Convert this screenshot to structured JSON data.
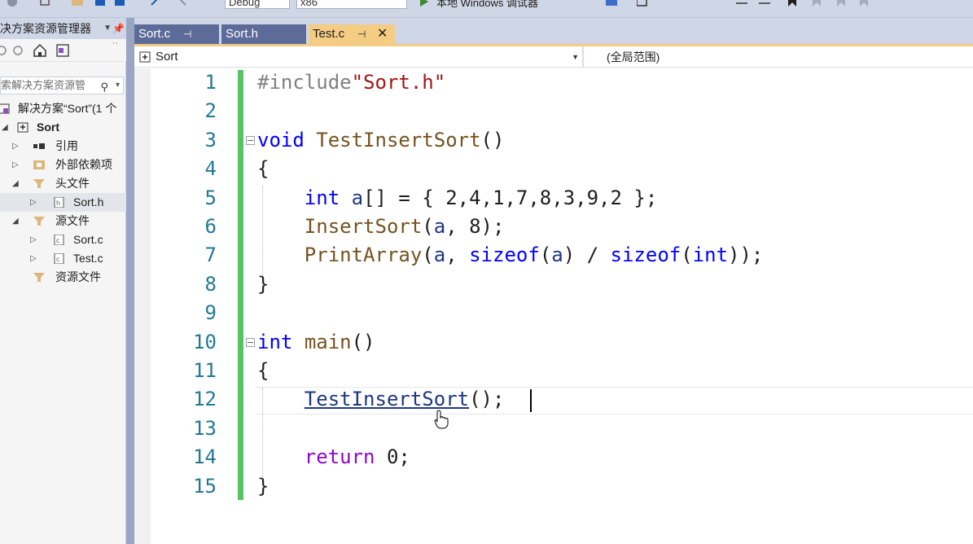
{
  "toolbar": {
    "config_value": "Debug",
    "platform_value": "x86",
    "run_label": "本地 Windows 调试器"
  },
  "explorer": {
    "title": "决方案资源管理器",
    "search_placeholder": "索解决方案资源管",
    "tree": [
      {
        "label": "解决方案“Sort”(1 个",
        "kind": "solution"
      },
      {
        "label": "Sort",
        "kind": "project"
      },
      {
        "label": "引用",
        "kind": "references"
      },
      {
        "label": "外部依赖项",
        "kind": "external-deps"
      },
      {
        "label": "头文件",
        "kind": "folder"
      },
      {
        "label": "Sort.h",
        "kind": "header-file"
      },
      {
        "label": "源文件",
        "kind": "folder"
      },
      {
        "label": "Sort.c",
        "kind": "source-file"
      },
      {
        "label": "Test.c",
        "kind": "source-file"
      },
      {
        "label": "资源文件",
        "kind": "folder"
      }
    ]
  },
  "tabs": [
    {
      "label": "Sort.c",
      "pinned": true,
      "active": false
    },
    {
      "label": "Sort.h",
      "pinned": false,
      "active": false
    },
    {
      "label": "Test.c",
      "pinned": true,
      "active": true
    }
  ],
  "navbar": {
    "project_scope": "Sort",
    "member_scope": "(全局范围)"
  },
  "editor": {
    "line_numbers": [
      "1",
      "2",
      "3",
      "4",
      "5",
      "6",
      "7",
      "8",
      "9",
      "10",
      "11",
      "12",
      "13",
      "14",
      "15"
    ],
    "lines": [
      "#include\"Sort.h\"",
      "",
      "void TestInsertSort()",
      "{",
      "    int a[] = { 2,4,1,7,8,3,9,2 };",
      "    InsertSort(a, 8);",
      "    PrintArray(a, sizeof(a) / sizeof(int));",
      "}",
      "",
      "int main()",
      "{",
      "    TestInsertSort();",
      "",
      "    return 0;",
      "}"
    ],
    "current_line": 12
  },
  "colors": {
    "line_number": "#237893",
    "keyword": "#0000ff",
    "control_keyword": "#8f08c4",
    "function": "#74531f",
    "string": "#a31515",
    "change_bar": "#57c364",
    "active_tab": "#f5cc84",
    "inactive_tab": "#5d6b99"
  }
}
